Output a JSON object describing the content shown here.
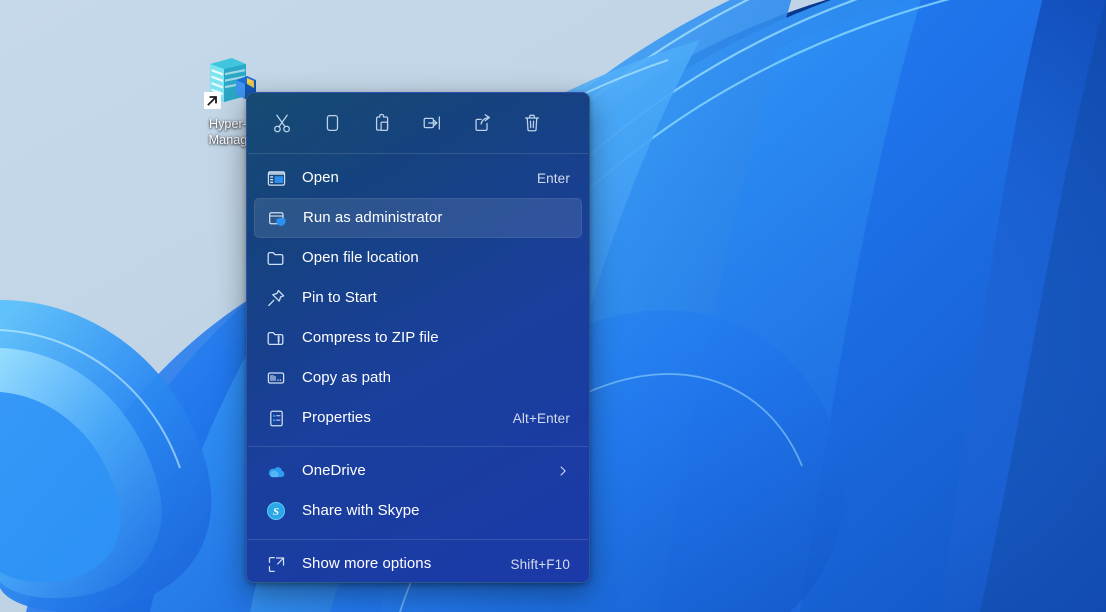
{
  "desktop": {
    "wallpaper_name": "windows-11-bloom",
    "colors": {
      "sky_top": "#c3d7e8",
      "sky_right": "#bdd1e3",
      "ribbon_light": "#59b6f5",
      "ribbon_mid": "#2b86f0",
      "ribbon_deep": "#1565d8",
      "ribbon_dark": "#0d49b0"
    },
    "icons": [
      {
        "name": "hyper-v-manager-shortcut",
        "label_line1": "Hyper-",
        "label_line2": "Manag",
        "full_label": "Hyper-V Manager",
        "has_shortcut_arrow": true
      }
    ]
  },
  "context_menu": {
    "command_bar": [
      {
        "name": "cut-icon",
        "label": "Cut"
      },
      {
        "name": "copy-icon",
        "label": "Copy"
      },
      {
        "name": "paste-icon",
        "label": "Paste"
      },
      {
        "name": "rename-icon",
        "label": "Rename"
      },
      {
        "name": "share-icon",
        "label": "Share"
      },
      {
        "name": "delete-icon",
        "label": "Delete"
      }
    ],
    "groups": [
      {
        "items": [
          {
            "icon": "open-window-icon",
            "label": "Open",
            "accel": "Enter",
            "selected": false,
            "submenu": false
          },
          {
            "icon": "shield-window-icon",
            "label": "Run as administrator",
            "accel": "",
            "selected": true,
            "submenu": false
          },
          {
            "icon": "folder-icon",
            "label": "Open file location",
            "accel": "",
            "selected": false,
            "submenu": false
          },
          {
            "icon": "pin-icon",
            "label": "Pin to Start",
            "accel": "",
            "selected": false,
            "submenu": false
          },
          {
            "icon": "zip-folder-icon",
            "label": "Compress to ZIP file",
            "accel": "",
            "selected": false,
            "submenu": false
          },
          {
            "icon": "copy-path-icon",
            "label": "Copy as path",
            "accel": "",
            "selected": false,
            "submenu": false
          },
          {
            "icon": "properties-icon",
            "label": "Properties",
            "accel": "Alt+Enter",
            "selected": false,
            "submenu": false
          }
        ]
      },
      {
        "items": [
          {
            "icon": "onedrive-icon",
            "label": "OneDrive",
            "accel": "",
            "selected": false,
            "submenu": true
          },
          {
            "icon": "skype-icon",
            "label": "Share with Skype",
            "accel": "",
            "selected": false,
            "submenu": false
          }
        ]
      },
      {
        "items": [
          {
            "icon": "show-more-icon",
            "label": "Show more options",
            "accel": "Shift+F10",
            "selected": false,
            "submenu": false
          }
        ]
      }
    ]
  }
}
